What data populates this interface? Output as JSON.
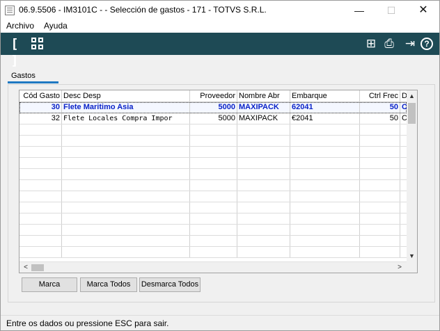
{
  "window": {
    "title": "06.9.5506 - IM3101C -  - Selección de gastos - 171 - TOTVS S.R.L.",
    "controls": {
      "minimize": "—",
      "maximize": "☐",
      "close": "✕"
    }
  },
  "menu": {
    "items": [
      "Archivo",
      "Ayuda"
    ]
  },
  "toolbar": {
    "background_color": "#1e4a55",
    "left_icons": [
      "expand-brackets-icon",
      "grid-view-icon"
    ],
    "right_icons": [
      "tree-structure-icon",
      "printer-icon",
      "exit-icon",
      "help-icon"
    ],
    "glyphs": {
      "brackets": "[ ]",
      "tree": "⊞",
      "printer": "⎙",
      "exit": "⇥",
      "help": "?"
    }
  },
  "tab": {
    "label": "Gastos",
    "accent_color": "#1f78c1"
  },
  "grid": {
    "columns": [
      "Cód Gasto",
      "Desc Desp",
      "Proveedor",
      "Nombre Abr",
      "Embarque",
      "Ctrl Frec",
      "D"
    ],
    "rows": [
      {
        "cod_gasto": "30",
        "desc_desp": "Flete Maritimo Asia",
        "proveedor": "5000",
        "nombre_abr": "MAXIPACK",
        "embarque": "62041",
        "ctrl_frec": "50",
        "d": "C",
        "selected": true
      },
      {
        "cod_gasto": "32",
        "desc_desp": "Flete Locales Compra Impor",
        "proveedor": "5000",
        "nombre_abr": "MAXIPACK",
        "embarque": "€2041",
        "ctrl_frec": "50",
        "d": "C",
        "selected": false
      }
    ],
    "selected_color": "#0a23c8",
    "scroll_glyphs": {
      "up": "▲",
      "down": "▼",
      "left": "<",
      "right": ">"
    }
  },
  "buttons": {
    "marca": "Marca",
    "marca_todos": "Marca Todos",
    "desmarca_todos": "Desmarca Todos"
  },
  "status": {
    "text": "Entre os dados ou pressione ESC para sair."
  }
}
